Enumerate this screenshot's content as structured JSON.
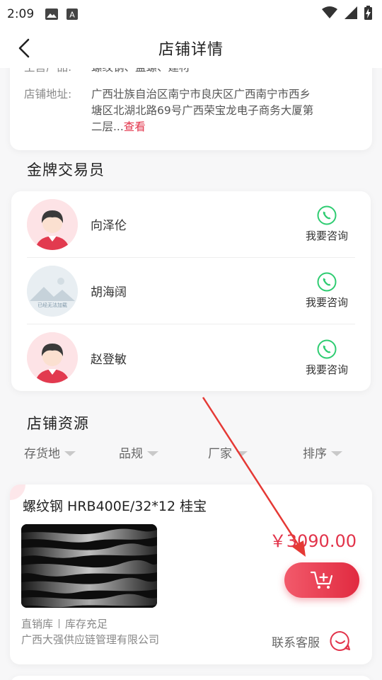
{
  "status_bar": {
    "time": "2:09",
    "left_icons": [
      "image-icon",
      "text-a-icon"
    ],
    "right_icons": [
      "wifi-icon",
      "signal-icon",
      "battery-charging-icon"
    ]
  },
  "header": {
    "title": "店铺详情",
    "back_icon": "chevron-left-icon"
  },
  "store_info": {
    "main_products_label": "主营产品:",
    "main_products_value": "螺纹钢、盘螺、建材",
    "address_label": "店铺地址:",
    "address_lines": [
      "广西壮族自治区南宁市良庆区广西南宁市西乡",
      "塘区北湖北路69号广西荣宝龙电子商务大厦第",
      "二层..."
    ],
    "address_more": "查看"
  },
  "traders_section": {
    "title": "金牌交易员",
    "consult_label": "我要咨询",
    "traders": [
      {
        "name": "向泽伦",
        "avatar": "female-avatar"
      },
      {
        "name": "胡海阔",
        "avatar": "landscape-placeholder",
        "avatar_text": "已经无法加载"
      },
      {
        "name": "赵登敏",
        "avatar": "female-avatar"
      }
    ]
  },
  "resources_section": {
    "title": "店铺资源",
    "filters": [
      "存货地",
      "品规",
      "厂家",
      "排序"
    ]
  },
  "product": {
    "title": "螺纹钢 HRB400E/32*12 桂宝",
    "price": "￥3090.00",
    "tag_1": "直销库",
    "tag_2": "库存充足",
    "company": "广西大强供应链管理有限公司",
    "service_label": "联系客服",
    "cart_icon": "add-to-cart-icon",
    "service_icon": "smile-chat-icon"
  },
  "colors": {
    "accent": "#e2334a",
    "consult_green": "#2ecc71",
    "annotation_arrow": "#e53935"
  }
}
